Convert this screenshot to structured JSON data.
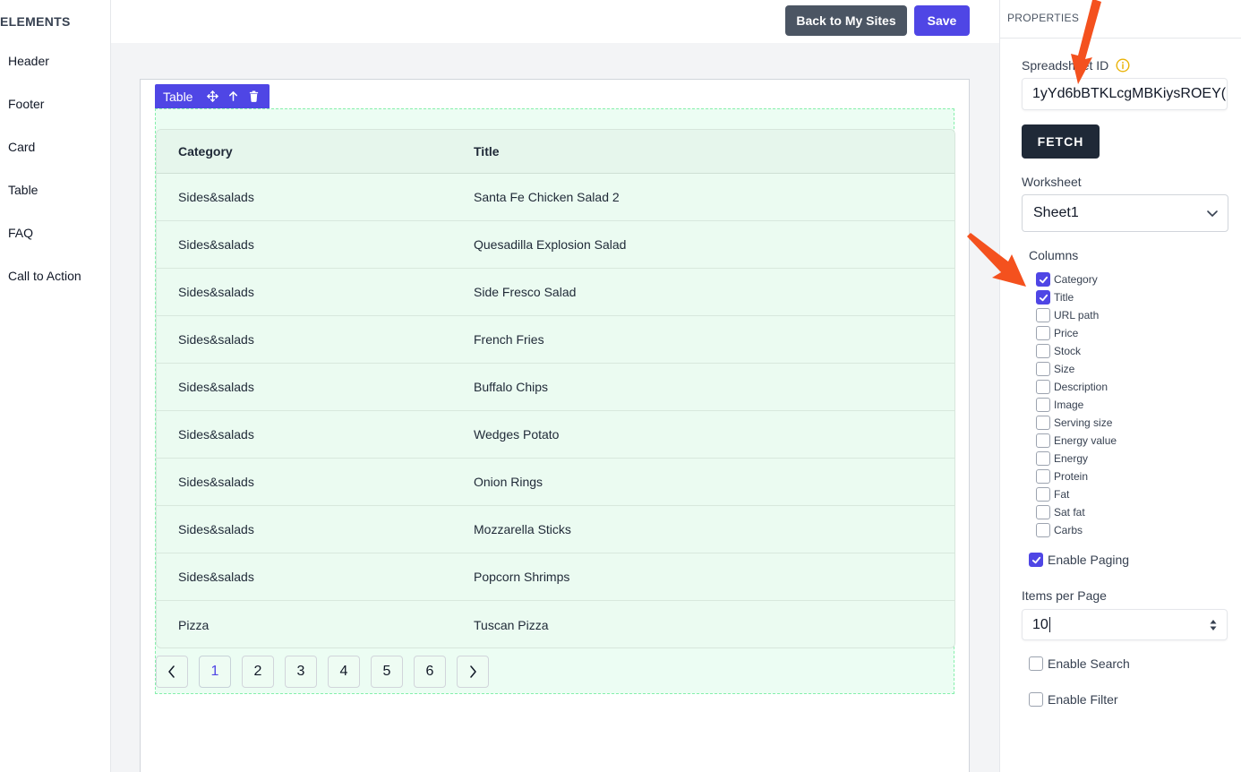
{
  "sidebar": {
    "title": "ELEMENTS",
    "items": [
      {
        "label": "Header"
      },
      {
        "label": "Footer"
      },
      {
        "label": "Card"
      },
      {
        "label": "Table"
      },
      {
        "label": "FAQ"
      },
      {
        "label": "Call to Action"
      }
    ]
  },
  "topbar": {
    "back_label": "Back to My Sites",
    "save_label": "Save"
  },
  "block": {
    "tag_label": "Table",
    "icons": [
      "move-icon",
      "arrow-up-icon",
      "trash-icon"
    ]
  },
  "table": {
    "headers": [
      "Category",
      "Title"
    ],
    "rows": [
      [
        "Sides&salads",
        "Santa Fe Chicken Salad 2"
      ],
      [
        "Sides&salads",
        "Quesadilla Explosion Salad"
      ],
      [
        "Sides&salads",
        "Side Fresco Salad"
      ],
      [
        "Sides&salads",
        "French Fries"
      ],
      [
        "Sides&salads",
        "Buffalo Chips"
      ],
      [
        "Sides&salads",
        "Wedges Potato"
      ],
      [
        "Sides&salads",
        "Onion Rings"
      ],
      [
        "Sides&salads",
        "Mozzarella Sticks"
      ],
      [
        "Sides&salads",
        "Popcorn Shrimps"
      ],
      [
        "Pizza",
        "Tuscan Pizza"
      ]
    ]
  },
  "pagination": {
    "pages": [
      "1",
      "2",
      "3",
      "4",
      "5",
      "6"
    ],
    "active": "1"
  },
  "properties": {
    "title": "PROPERTIES",
    "spreadsheet_label": "Spreadsheet ID",
    "spreadsheet_value": "1yYd6bBTKLcgMBKiysROEY(",
    "fetch_label": "FETCH",
    "worksheet_label": "Worksheet",
    "worksheet_value": "Sheet1",
    "columns_label": "Columns",
    "columns": [
      {
        "label": "Category",
        "checked": true
      },
      {
        "label": "Title",
        "checked": true
      },
      {
        "label": "URL path",
        "checked": false
      },
      {
        "label": "Price",
        "checked": false
      },
      {
        "label": "Stock",
        "checked": false
      },
      {
        "label": "Size",
        "checked": false
      },
      {
        "label": "Description",
        "checked": false
      },
      {
        "label": "Image",
        "checked": false
      },
      {
        "label": "Serving size",
        "checked": false
      },
      {
        "label": "Energy value",
        "checked": false
      },
      {
        "label": "Energy",
        "checked": false
      },
      {
        "label": "Protein",
        "checked": false
      },
      {
        "label": "Fat",
        "checked": false
      },
      {
        "label": "Sat fat",
        "checked": false
      },
      {
        "label": "Carbs",
        "checked": false
      }
    ],
    "enable_paging_label": "Enable Paging",
    "enable_paging": true,
    "items_per_page_label": "Items per Page",
    "items_per_page": "10",
    "enable_search_label": "Enable Search",
    "enable_search": false,
    "enable_filter_label": "Enable Filter",
    "enable_filter": false
  },
  "colors": {
    "primary": "#4f46e5",
    "dark_button": "#4b5563",
    "fetch_button": "#1f2937",
    "table_bg": "#ecfdf3",
    "arrow": "#f4511e"
  }
}
